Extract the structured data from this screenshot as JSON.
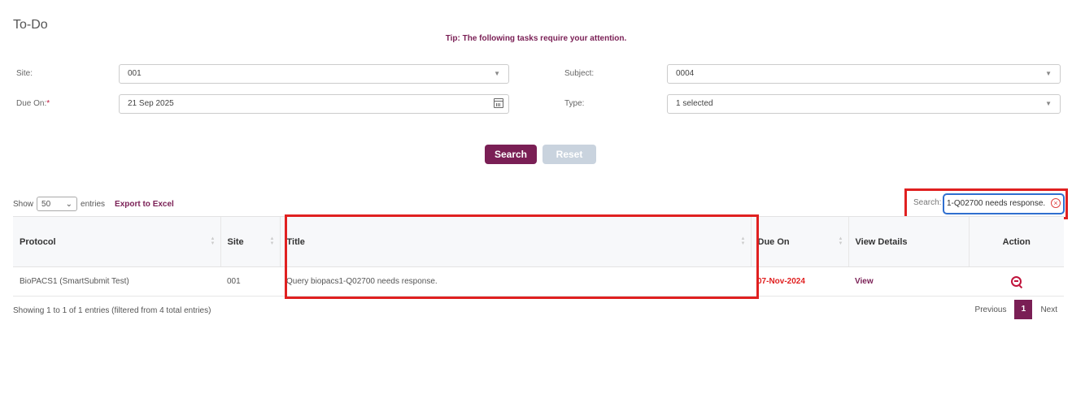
{
  "page": {
    "title": "To-Do",
    "tip": "Tip: The following tasks require your attention."
  },
  "filters": {
    "site_label": "Site:",
    "site_value": "001",
    "subject_label": "Subject:",
    "subject_value": "0004",
    "due_label": "Due On:",
    "due_required": "*",
    "due_value": "21 Sep 2025",
    "type_label": "Type:",
    "type_value": "1 selected"
  },
  "buttons": {
    "search": "Search",
    "reset": "Reset"
  },
  "toolbar": {
    "show": "Show",
    "length": "50",
    "entries": "entries",
    "export": "Export to Excel",
    "search_label": "Search:",
    "search_value": "1-Q02700 needs response."
  },
  "table": {
    "headers": [
      "Protocol",
      "Site",
      "Title",
      "Due On",
      "View Details",
      "Action"
    ],
    "rows": [
      {
        "protocol": "BioPACS1 (SmartSubmit Test)",
        "site": "001",
        "title": "Query biopacs1-Q02700 needs response.",
        "due": "07-Nov-2024",
        "view": "View",
        "action_icon": "query-icon"
      }
    ]
  },
  "footer": {
    "info": "Showing 1 to 1 of 1 entries (filtered from 4 total entries)",
    "previous": "Previous",
    "page": "1",
    "next": "Next"
  },
  "colors": {
    "brand": "#7a1f55",
    "highlight": "#e02020",
    "due": "#e02020"
  }
}
